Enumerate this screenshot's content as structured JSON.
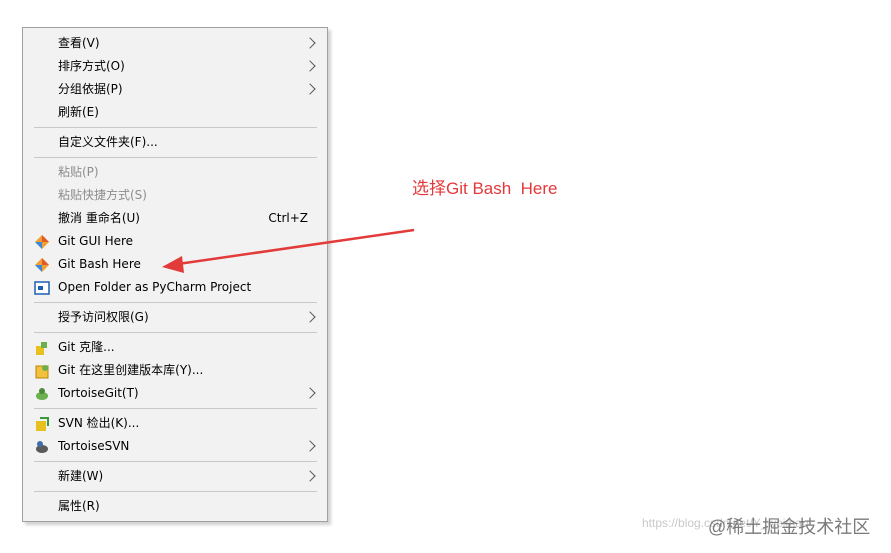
{
  "menu": {
    "items": [
      {
        "label": "查看(V)",
        "submenu": true
      },
      {
        "label": "排序方式(O)",
        "submenu": true
      },
      {
        "label": "分组依据(P)",
        "submenu": true
      },
      {
        "label": "刷新(E)"
      },
      {
        "label": "自定义文件夹(F)..."
      },
      {
        "label": "粘贴(P)",
        "disabled": true
      },
      {
        "label": "粘贴快捷方式(S)",
        "disabled": true
      },
      {
        "label": "撤消 重命名(U)",
        "shortcut": "Ctrl+Z"
      },
      {
        "label": "Git GUI Here",
        "icon": "git-icon"
      },
      {
        "label": "Git Bash Here",
        "icon": "git-icon"
      },
      {
        "label": "Open Folder as PyCharm Project",
        "icon": "pycharm-icon"
      },
      {
        "label": "授予访问权限(G)",
        "submenu": true
      },
      {
        "label": "Git 克隆...",
        "icon": "tortoisegit-clone-icon"
      },
      {
        "label": "Git 在这里创建版本库(Y)...",
        "icon": "tortoisegit-repo-icon"
      },
      {
        "label": "TortoiseGit(T)",
        "icon": "tortoisegit-icon",
        "submenu": true
      },
      {
        "label": "SVN 检出(K)...",
        "icon": "svn-checkout-icon"
      },
      {
        "label": "TortoiseSVN",
        "icon": "tortoisesvn-icon",
        "submenu": true
      },
      {
        "label": "新建(W)",
        "submenu": true
      },
      {
        "label": "属性(R)"
      }
    ]
  },
  "annotation": {
    "text": "选择Git Bash  Here",
    "color": "#e4393c"
  },
  "watermark": {
    "url": "https://blog.csdn.net/Y_weimao",
    "site": "@稀土掘金技术社区"
  }
}
